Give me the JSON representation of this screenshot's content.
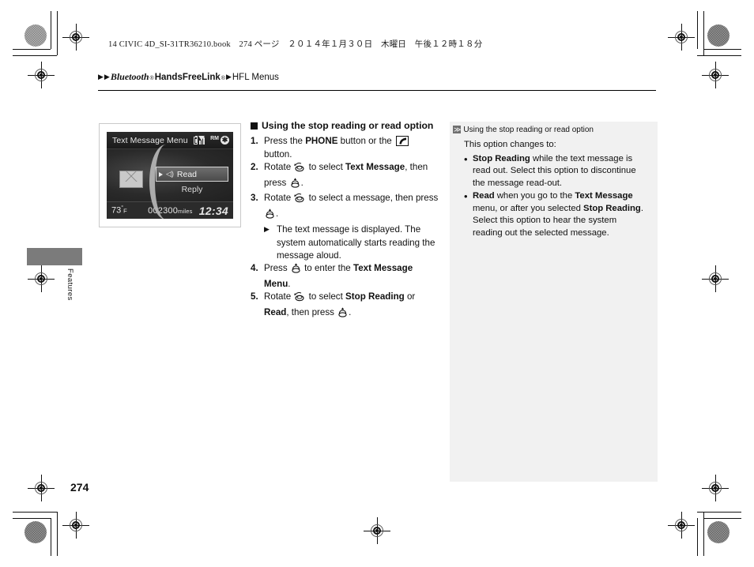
{
  "header": {
    "running_head": "14 CIVIC 4D_SI-31TR36210.book　274 ページ　２０１４年１月３０日　木曜日　午後１２時１８分"
  },
  "breadcrumb": {
    "tri1": "▶",
    "tri2": "▶",
    "item1": "Bluetooth",
    "item1_sup": "®",
    "item2": "HandsFreeLink",
    "item2_sup": "®",
    "tri3": "▶",
    "item3": "HFL Menus"
  },
  "thumb_tab": {
    "label": "Features"
  },
  "page_number": "274",
  "lcd": {
    "title": "Text Message Menu",
    "status": {
      "roaming": "RM",
      "bluetooth": "✱"
    },
    "menu_items": [
      {
        "label": "Read",
        "selected": true
      },
      {
        "label": "Reply",
        "selected": false
      }
    ],
    "footer": {
      "temperature": "73",
      "temp_degree": "°",
      "temp_unit": "F",
      "odometer": "002300",
      "odometer_unit": "miles",
      "clock": "12:34"
    }
  },
  "steps": {
    "heading": "Using the stop reading or read option",
    "items": [
      {
        "pre": "Press the ",
        "bold1": "PHONE",
        "mid": " button or the ",
        "icon": "phone-handset-button",
        "post": " button."
      },
      {
        "pre": "Rotate ",
        "icon1": "rotary-knob-rotate",
        "mid": " to select ",
        "bold1": "Text Message",
        "mid2": ", then press ",
        "icon2": "rotary-knob-press",
        "post": "."
      },
      {
        "pre": "Rotate ",
        "icon1": "rotary-knob-rotate",
        "mid": " to select a message, then press ",
        "icon2": "rotary-knob-press",
        "post": ".",
        "subnote": "The text message is displayed. The system automatically starts reading the message aloud."
      },
      {
        "pre": "Press ",
        "icon1": "rotary-knob-press",
        "mid": " to enter the ",
        "bold1": "Text Message Menu",
        "post": "."
      },
      {
        "pre": "Rotate ",
        "icon1": "rotary-knob-rotate",
        "mid": " to select ",
        "bold1": "Stop Reading",
        "mid2": " or ",
        "bold2": "Read",
        "mid3": ", then press ",
        "icon2": "rotary-knob-press",
        "post": "."
      }
    ]
  },
  "note_panel": {
    "title": "Using the stop reading or read option",
    "lead": "This option changes to:",
    "bullets": [
      {
        "bold1": "Stop Reading",
        "text1": " while the text message is read out. Select this option to discontinue the message read-out."
      },
      {
        "bold1": "Read",
        "text1": " when you go to the ",
        "bold2": "Text Message",
        "text2": " menu, or after you selected ",
        "bold3": "Stop Reading",
        "text3": ". Select this option to hear the system reading out the selected message."
      }
    ]
  },
  "colors": {
    "note_panel_bg": "#f1f1f1",
    "thumb_tab": "#7b7b7b",
    "lcd_bg": "#1e1e1e",
    "text": "#111111"
  }
}
